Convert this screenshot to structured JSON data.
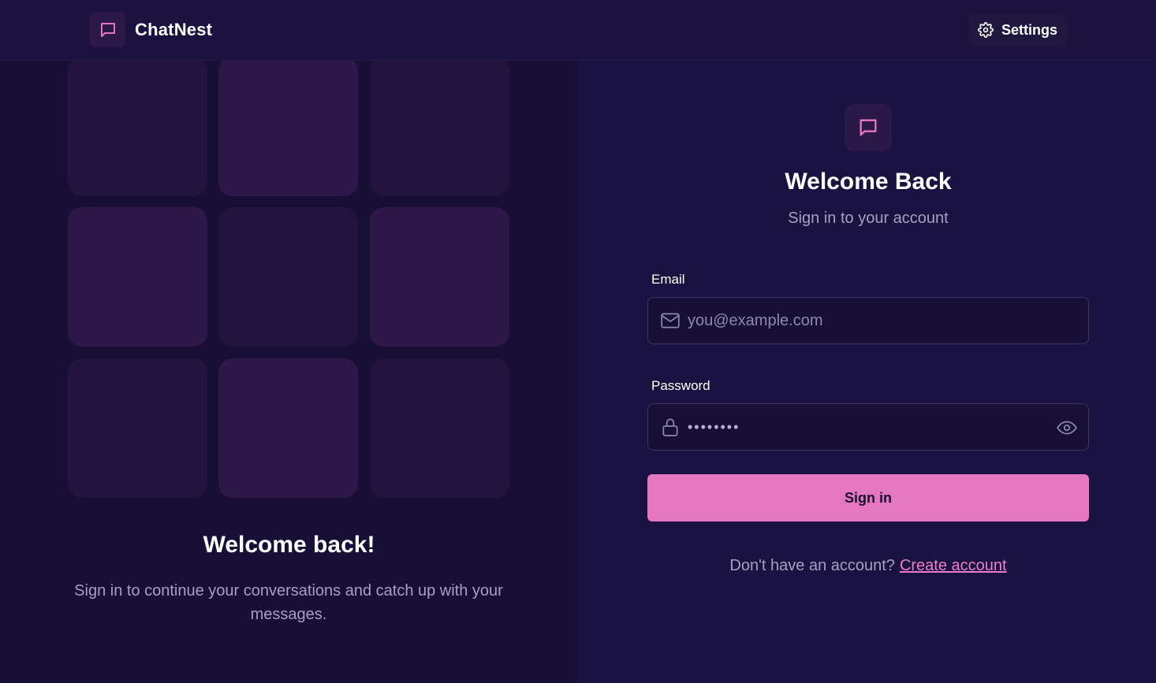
{
  "header": {
    "app_name": "ChatNest",
    "settings_label": "Settings"
  },
  "left": {
    "title": "Welcome back!",
    "subtitle": "Sign in to continue your conversations and catch up with your messages."
  },
  "form": {
    "title": "Welcome Back",
    "subtitle": "Sign in to your account",
    "email_label": "Email",
    "email_placeholder": "you@example.com",
    "password_label": "Password",
    "password_value": "••••••••",
    "signin_label": "Sign in",
    "no_account_text": "Don't have an account?",
    "create_account_label": "Create account"
  },
  "colors": {
    "accent": "#e577c0",
    "background": "#170f35",
    "panel": "#1a1240"
  },
  "icons": [
    "chat-bubble-icon",
    "gear-icon",
    "mail-icon",
    "lock-icon",
    "eye-icon"
  ]
}
